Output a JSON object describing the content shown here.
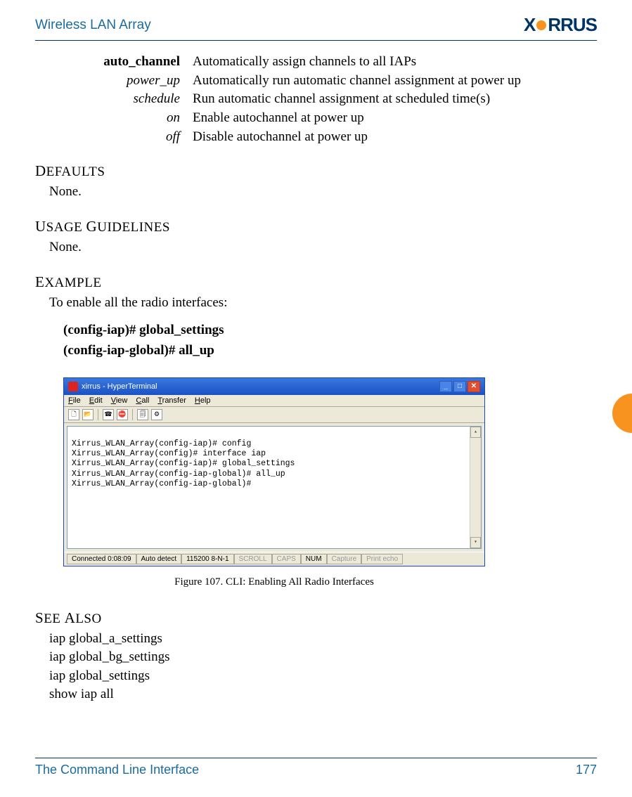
{
  "header": {
    "title": "Wireless LAN Array",
    "logo_prefix": "X",
    "logo_suffix": "RRUS"
  },
  "definitions": [
    {
      "key": "auto_channel",
      "style": "bold",
      "desc": "Automatically assign channels to all IAPs"
    },
    {
      "key": "power_up",
      "style": "italic",
      "desc": "Automatically run automatic channel assignment at power up"
    },
    {
      "key": "schedule",
      "style": "italic",
      "desc": "Run automatic channel assignment at scheduled time(s)"
    },
    {
      "key": "on",
      "style": "italic",
      "desc": "Enable autochannel at power up"
    },
    {
      "key": "off",
      "style": "italic",
      "desc": "Disable autochannel at power up"
    }
  ],
  "sections": {
    "defaults": {
      "head_first": "D",
      "head_rest": "EFAULTS",
      "body": "None."
    },
    "usage": {
      "head_first": "U",
      "head_mid": "SAGE ",
      "head_g": "G",
      "head_rest": "UIDELINES",
      "body": "None."
    },
    "example": {
      "head_first": "E",
      "head_rest": "XAMPLE",
      "body": "To enable all the radio interfaces:",
      "cmd1": "(config-iap)# global_settings",
      "cmd2": "(config-iap-global)# all_up"
    },
    "seealso": {
      "head_first": "S",
      "head_mid": "EE ",
      "head_a": "A",
      "head_rest": "LSO",
      "items": [
        "iap global_a_settings",
        "iap global_bg_settings",
        "iap global_settings",
        "show iap all"
      ]
    }
  },
  "hyperterm": {
    "title": "xirrus - HyperTerminal",
    "menu": [
      "File",
      "Edit",
      "View",
      "Call",
      "Transfer",
      "Help"
    ],
    "term_lines": [
      "Xirrus_WLAN_Array(config-iap)# config",
      "Xirrus_WLAN_Array(config)# interface iap",
      "Xirrus_WLAN_Array(config-iap)# global_settings",
      "Xirrus_WLAN_Array(config-iap-global)# all_up",
      "Xirrus_WLAN_Array(config-iap-global)#"
    ],
    "status": {
      "connected": "Connected 0:08:09",
      "detect": "Auto detect",
      "baud": "115200 8-N-1",
      "scroll": "SCROLL",
      "caps": "CAPS",
      "num": "NUM",
      "capture": "Capture",
      "echo": "Print echo"
    }
  },
  "figure_caption": "Figure 107. CLI: Enabling All Radio Interfaces",
  "footer": {
    "left": "The Command Line Interface",
    "right": "177"
  }
}
